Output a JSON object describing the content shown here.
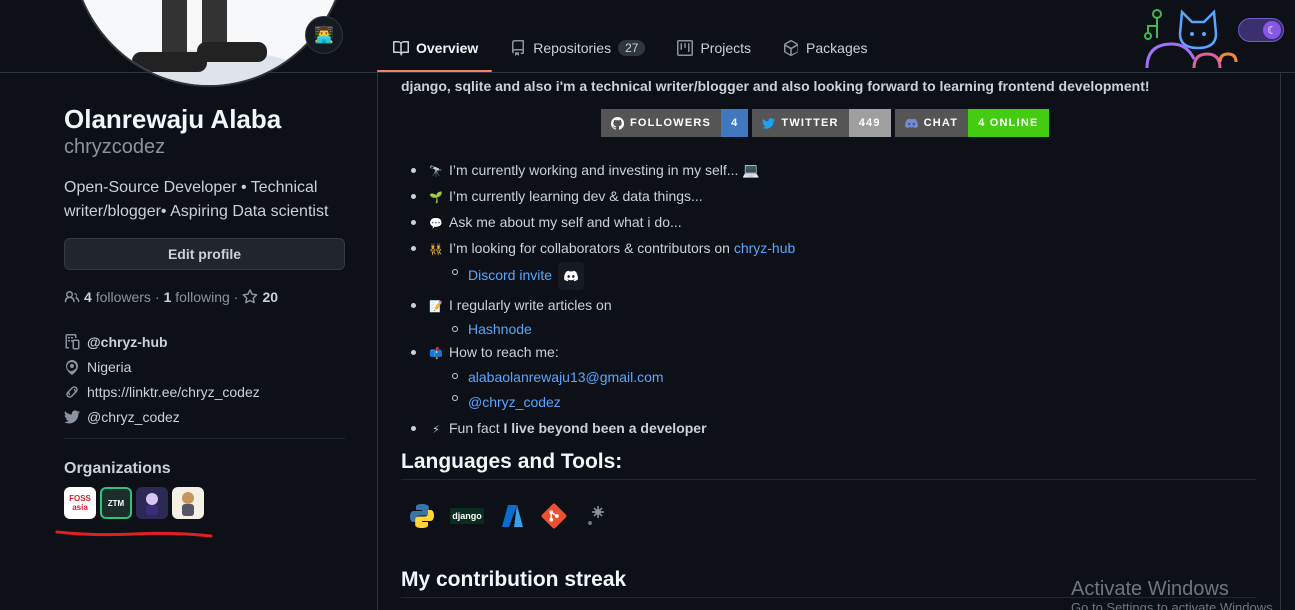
{
  "tabs": [
    {
      "label": "Overview",
      "icon": "book-icon"
    },
    {
      "label": "Repositories",
      "icon": "repo-icon",
      "count": "27"
    },
    {
      "label": "Projects",
      "icon": "project-icon"
    },
    {
      "label": "Packages",
      "icon": "package-icon"
    }
  ],
  "profile": {
    "status_emoji": "👨‍💻",
    "name": "Olanrewaju Alaba",
    "login": "chryzcodez",
    "bio": "Open-Source Developer • Technical writer/blogger• Aspiring Data scientist",
    "edit_label": "Edit profile",
    "followers_count": "4",
    "followers_label": "followers",
    "following_count": "1",
    "following_label": "following",
    "stars_count": "20",
    "org": "@chryz-hub",
    "location": "Nigeria",
    "website": "https://linktr.ee/chryz_codez",
    "twitter": "@chryz_codez"
  },
  "organizations": {
    "title": "Organizations",
    "items": [
      {
        "name": "fossasia",
        "text": "FOSS asia",
        "bg": "#ffffff",
        "fg": "#d9232d"
      },
      {
        "name": "ztm",
        "text": "ZTM",
        "bg": "#1c2e2a",
        "fg": "#ffffff"
      },
      {
        "name": "org-3",
        "text": "",
        "bg": "#2b2a55",
        "fg": "#ffffff"
      },
      {
        "name": "org-4",
        "text": "",
        "bg": "#f5f0e6",
        "fg": "#333333"
      }
    ]
  },
  "readme": {
    "intro": "django, sqlite and also i'm a technical writer/blogger and also looking forward to learning frontend development!",
    "badges": [
      {
        "left": "FOLLOWERS",
        "right": "4",
        "color": "#4078c0",
        "icon": "github-icon"
      },
      {
        "left": "TWITTER",
        "right": "449",
        "color": "#9f9f9f",
        "icon": "twitter-icon"
      },
      {
        "left": "CHAT",
        "right": "4 ONLINE",
        "color": "#4c1",
        "icon": "discord-icon"
      }
    ],
    "items": [
      {
        "emoji": "🔭",
        "text": "I’m currently working and investing in my self... 💻"
      },
      {
        "emoji": "🌱",
        "text": "I’m currently learning dev & data things..."
      },
      {
        "emoji": "💬",
        "text": "Ask me about my self and what i do..."
      },
      {
        "emoji": "👯",
        "text": "I’m looking for collaborators & contributors on ",
        "link": "chryz-hub",
        "sub": [
          "Discord invite"
        ]
      },
      {
        "emoji": "📝",
        "text": "I regularly write articles on",
        "sub": [
          "Hashnode"
        ]
      },
      {
        "emoji": "📫",
        "text": "How to reach me:",
        "sub": [
          "alabaolanrewaju13@gmail.com",
          "@chryz_codez"
        ]
      },
      {
        "emoji": "⚡",
        "text": "Fun fact ",
        "bold": "I live beyond been a developer"
      }
    ],
    "languages_title": "Languages and Tools:",
    "tools": [
      "python-icon",
      "django-icon",
      "azure-icon",
      "git-icon",
      "sqlite-icon"
    ],
    "django_label": "django",
    "streak_title": "My contribution streak"
  },
  "watermark": {
    "title": "Activate Windows",
    "sub": "Go to Settings to activate Windows."
  }
}
